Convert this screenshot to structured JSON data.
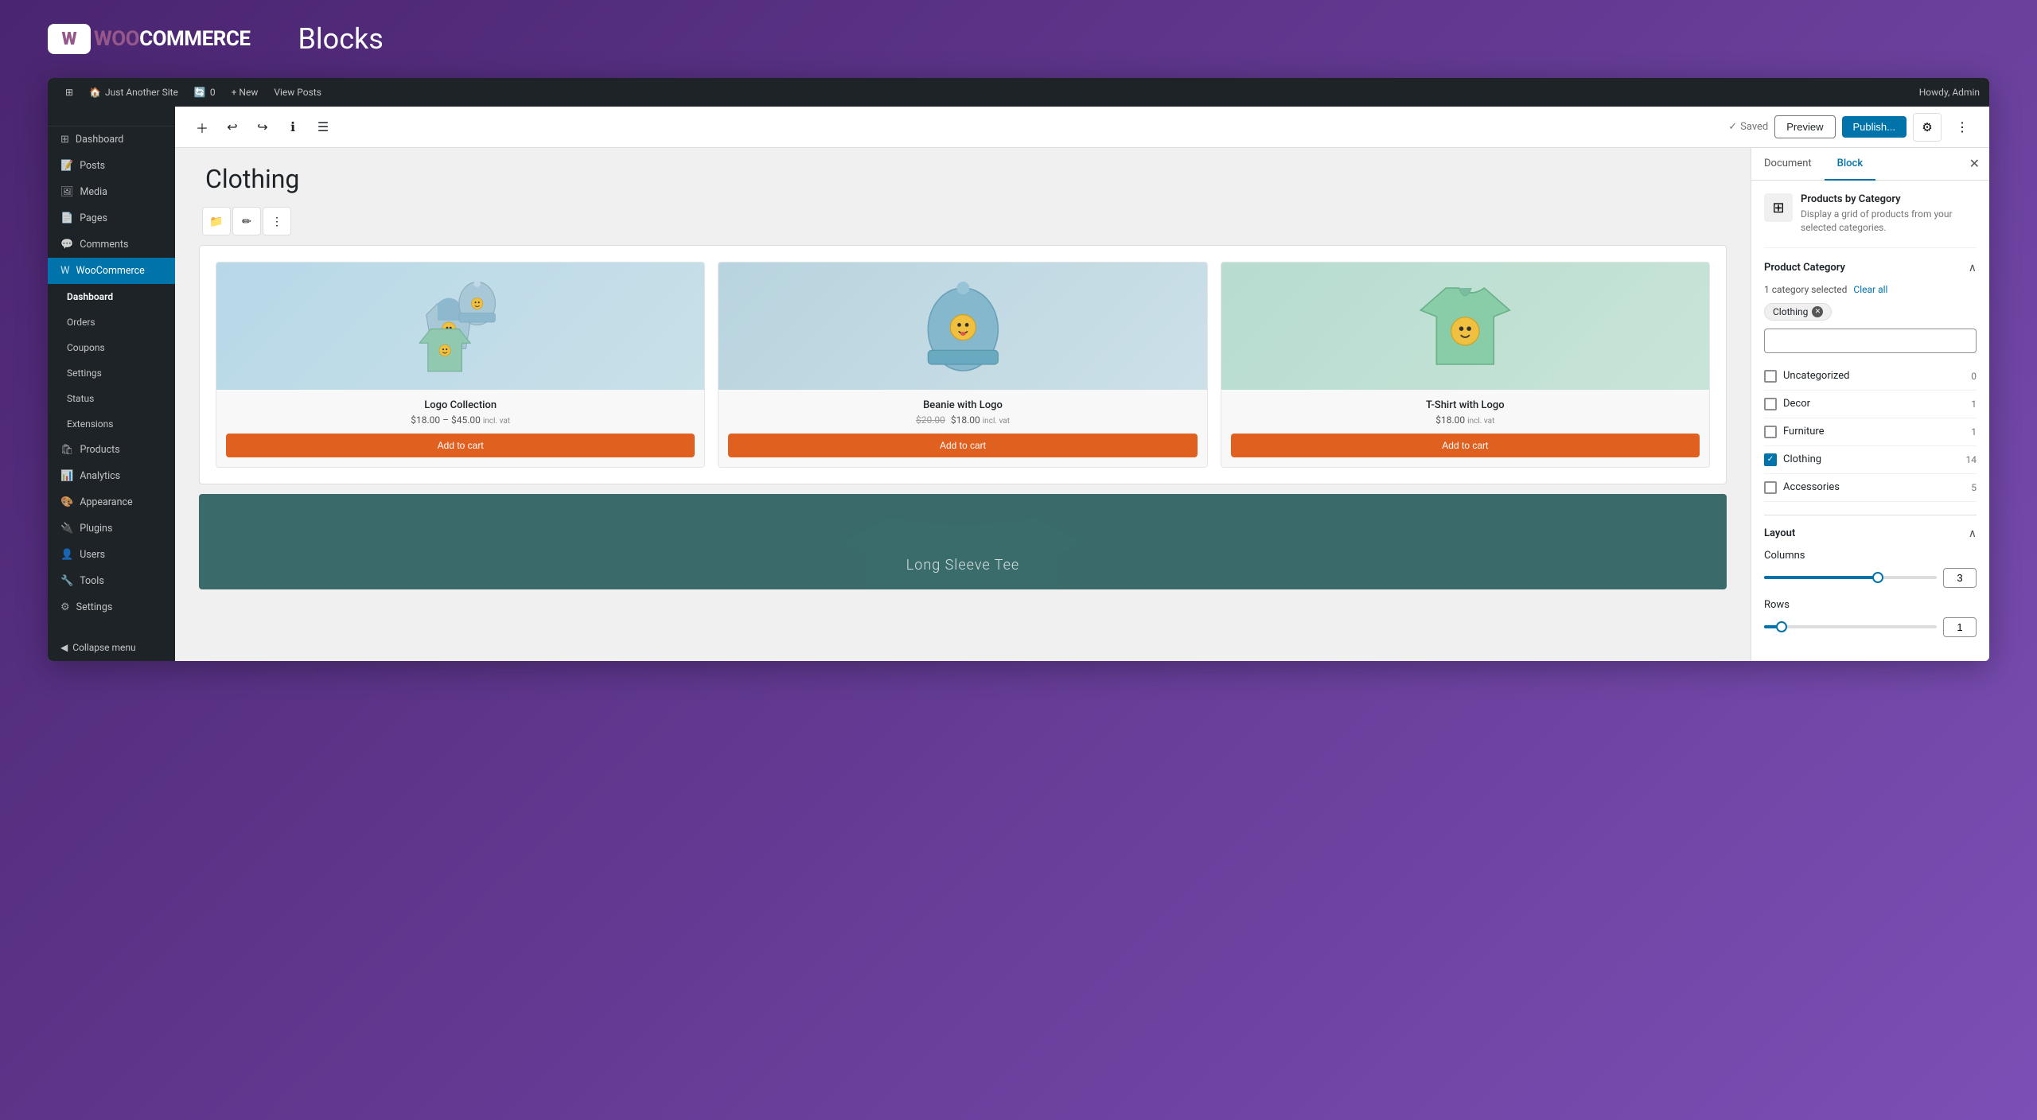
{
  "banner": {
    "logo_text_woo": "WOO",
    "logo_text_commerce": "COMMERCE",
    "title": "Blocks"
  },
  "admin_bar": {
    "wp_icon": "⊞",
    "site_name": "Just Another Site",
    "update_count": "0",
    "new_label": "+ New",
    "view_posts": "View Posts",
    "howdy": "Howdy, Admin"
  },
  "sidebar": {
    "items": [
      {
        "label": "Dashboard",
        "icon": "⊞"
      },
      {
        "label": "Posts",
        "icon": "📝"
      },
      {
        "label": "Media",
        "icon": "🖼"
      },
      {
        "label": "Pages",
        "icon": "📄"
      },
      {
        "label": "Comments",
        "icon": "💬"
      },
      {
        "label": "WooCommerce",
        "icon": "W"
      },
      {
        "label": "Dashboard",
        "sub": true
      },
      {
        "label": "Orders",
        "sub": true
      },
      {
        "label": "Coupons",
        "sub": true
      },
      {
        "label": "Settings",
        "sub": true
      },
      {
        "label": "Status",
        "sub": true
      },
      {
        "label": "Extensions",
        "sub": true
      },
      {
        "label": "Products",
        "icon": "🛍"
      },
      {
        "label": "Analytics",
        "icon": "📊"
      },
      {
        "label": "Appearance",
        "icon": "🎨"
      },
      {
        "label": "Plugins",
        "icon": "🔌"
      },
      {
        "label": "Users",
        "icon": "👤"
      },
      {
        "label": "Tools",
        "icon": "🔧"
      },
      {
        "label": "Settings",
        "icon": "⚙"
      }
    ],
    "collapse_label": "Collapse menu"
  },
  "editor": {
    "toolbar": {
      "add_block_icon": "+",
      "undo_icon": "↩",
      "redo_icon": "↪",
      "info_icon": "ℹ",
      "list_view_icon": "☰",
      "saved_label": "Saved",
      "preview_label": "Preview",
      "publish_label": "Publish...",
      "gear_icon": "⚙",
      "more_icon": "⋮"
    },
    "page_title": "Clothing",
    "block_tools": {
      "folder_icon": "📁",
      "edit_icon": "✏",
      "more_icon": "⋮"
    }
  },
  "products": [
    {
      "name": "Logo Collection",
      "price_original": "",
      "price_sale": "$18.00 – $45.00",
      "price_incl": "incl. vat",
      "add_to_cart": "Add to cart",
      "type": "clothing"
    },
    {
      "name": "Beanie with Logo",
      "price_original": "$20.00",
      "price_sale": "$18.00",
      "price_incl": "incl. vat",
      "add_to_cart": "Add to cart",
      "type": "beanie"
    },
    {
      "name": "T-Shirt with Logo",
      "price_original": "",
      "price_sale": "$18.00",
      "price_incl": "incl. vat",
      "add_to_cart": "Add to cart",
      "type": "tshirt"
    }
  ],
  "longsleeve": {
    "text": "Long Sleeve Tee"
  },
  "panel": {
    "tab_document": "Document",
    "tab_block": "Block",
    "block_info": {
      "title": "Products by Category",
      "description": "Display a grid of products from your selected categories."
    },
    "product_category": {
      "section_title": "Product Category",
      "selected_count": "1 category selected",
      "clear_all": "Clear all",
      "selected_tag": "Clothing",
      "search_placeholder": "",
      "categories": [
        {
          "name": "Uncategorized",
          "count": "0",
          "checked": false
        },
        {
          "name": "Decor",
          "count": "1",
          "checked": false
        },
        {
          "name": "Furniture",
          "count": "1",
          "checked": false
        },
        {
          "name": "Clothing",
          "count": "14",
          "checked": true
        },
        {
          "name": "Accessories",
          "count": "5",
          "checked": false
        }
      ]
    },
    "layout": {
      "section_title": "Layout",
      "columns_label": "Columns",
      "columns_value": "3",
      "columns_slider_pct": 66,
      "rows_label": "Rows",
      "rows_value": "1",
      "rows_slider_pct": 10
    }
  }
}
